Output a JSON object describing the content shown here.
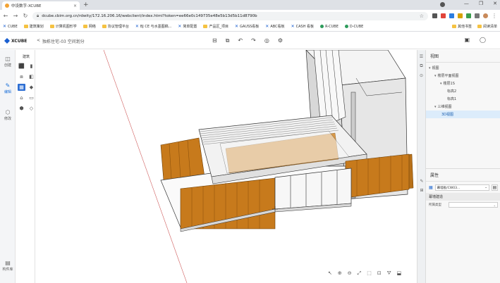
{
  "browser": {
    "tab_title": "中设数字-XCUBE",
    "tab_close": "×",
    "new_tab": "+",
    "url": "dcube.cbim.org.cn/rdwity/172.16.206.16/webclient/index.html?token=ee66e0c149735e48e5b13d5b11d8790b",
    "window_controls": [
      "—",
      "❐",
      "✕"
    ],
    "bookmarks": [
      {
        "label": "CUBE",
        "type": "xcube"
      },
      {
        "label": "建筑策划",
        "type": "folder"
      },
      {
        "label": "计算机图形学",
        "type": "folder"
      },
      {
        "label": "网络",
        "type": "folder"
      },
      {
        "label": "协议管理平台",
        "type": "folder"
      },
      {
        "label": "BJ CE 与水墨图稿...",
        "type": "xcube"
      },
      {
        "label": "简单配置",
        "type": "xcube"
      },
      {
        "label": "产品区_项目",
        "type": "folder"
      },
      {
        "label": "GAUSS看板",
        "type": "xcube"
      },
      {
        "label": "ABC看板",
        "type": "xcube"
      },
      {
        "label": "CASH 看板",
        "type": "xcube"
      },
      {
        "label": "R-CUBE",
        "type": "dot"
      },
      {
        "label": "D-CUBE",
        "type": "dot"
      }
    ],
    "bookmarks_right": [
      "其他书签",
      "阅读清单"
    ]
  },
  "app": {
    "logo_text": "XCUBE",
    "breadcrumb_back": "<",
    "breadcrumb": "独栋住宅-03 空间划分",
    "center_tools": [
      "⊟",
      "⧉",
      "↶",
      "↷",
      "◎",
      "⚙"
    ],
    "right_tools": [
      "▣",
      "◯"
    ]
  },
  "rail": {
    "items": [
      {
        "label": "创建",
        "icon": "◫",
        "active": false
      },
      {
        "label": "编辑",
        "icon": "✎",
        "active": true
      },
      {
        "label": "修改",
        "icon": "⬡",
        "active": false
      }
    ],
    "bottom_label": "构件库",
    "bottom_icon": "▤"
  },
  "toolpanel": {
    "title": "建筑",
    "tools": [
      "⬛",
      "▮",
      "⧈",
      "◧",
      "▦",
      "◆",
      "⌂",
      "▭",
      "⬢",
      "◇"
    ]
  },
  "viewport": {
    "nav_tools": [
      "↖",
      "⊕",
      "⊖",
      "⤢",
      "⬚",
      "⊡",
      "⛛",
      "⬓"
    ]
  },
  "rightpanel": {
    "vrail_icons": [
      "☰",
      "⧉",
      "⊙"
    ],
    "views_title": "视图",
    "tree": [
      {
        "label": "视图",
        "depth": 0,
        "caret": "▾",
        "selected": false
      },
      {
        "label": "楼层平面视图",
        "depth": 1,
        "caret": "▾",
        "selected": false
      },
      {
        "label": "楼层1S",
        "depth": 2,
        "caret": "▾",
        "selected": false
      },
      {
        "label": "标高2",
        "depth": 3,
        "caret": "",
        "selected": false
      },
      {
        "label": "标高1",
        "depth": 3,
        "caret": "",
        "selected": false
      },
      {
        "label": "三维视图",
        "depth": 1,
        "caret": "▾",
        "selected": false
      },
      {
        "label": "3D视图",
        "depth": 2,
        "caret": "",
        "selected": true
      }
    ],
    "props_title": "属性",
    "prop_type": "幕墙板/CW03...",
    "prop_type_caret": "⌄",
    "prop_section": "幕墙建造",
    "prop_row_label": "所属类型",
    "prop_row_value": "⌄"
  },
  "colors": {
    "accent": "#1a6fd8",
    "wood": "#c77a1c",
    "wood_dark": "#9c5a10",
    "glass": "#eeeeee",
    "line": "#333333"
  }
}
